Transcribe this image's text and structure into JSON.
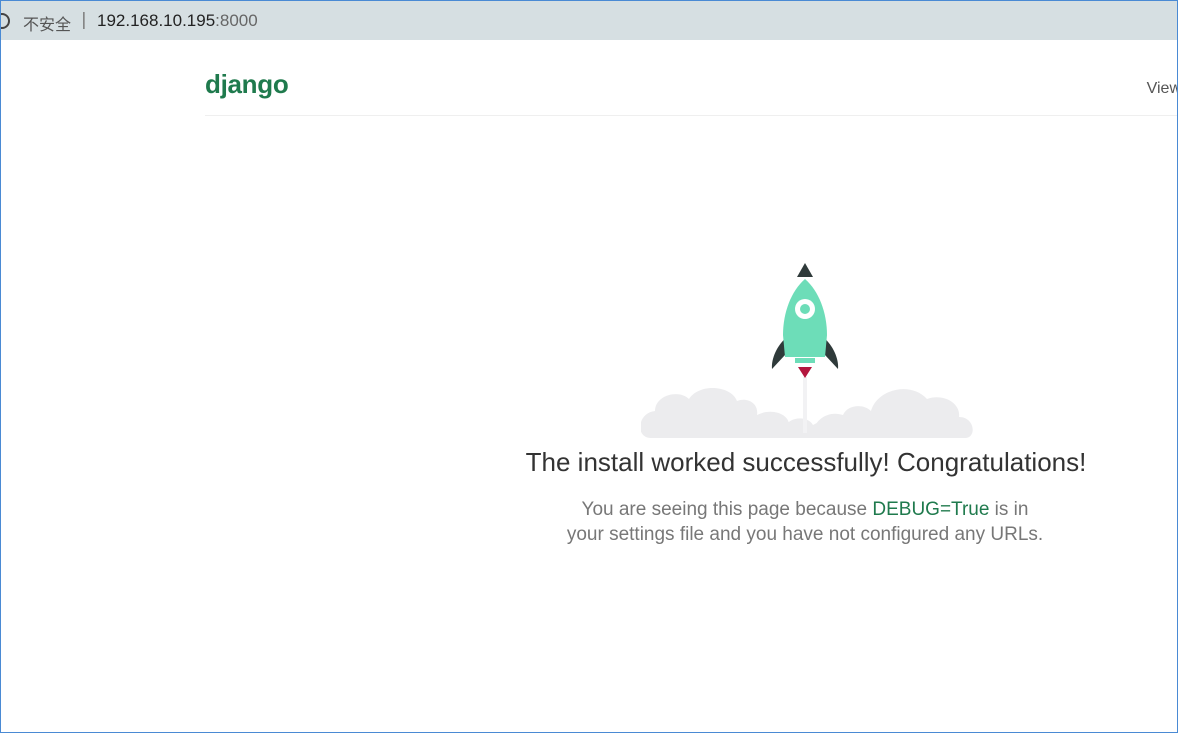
{
  "browser": {
    "security_label": "不安全",
    "separator": "|",
    "url_host": "192.168.10.195",
    "url_port": ":8000"
  },
  "header": {
    "logo": "django",
    "view_link": "View"
  },
  "main": {
    "title": "The install worked successfully! Congratulations!",
    "desc_before": "You are seeing this page because ",
    "desc_debug": "DEBUG=True",
    "desc_after": " is in your settings file and you have not configured any URLs."
  },
  "colors": {
    "brand_green": "#1f7a4d",
    "rocket_body": "#6dddb8",
    "rocket_dark": "#2f3a3a",
    "flame": "#b3153d",
    "cloud": "#ececee",
    "address_bar": "#d6dfe2"
  }
}
